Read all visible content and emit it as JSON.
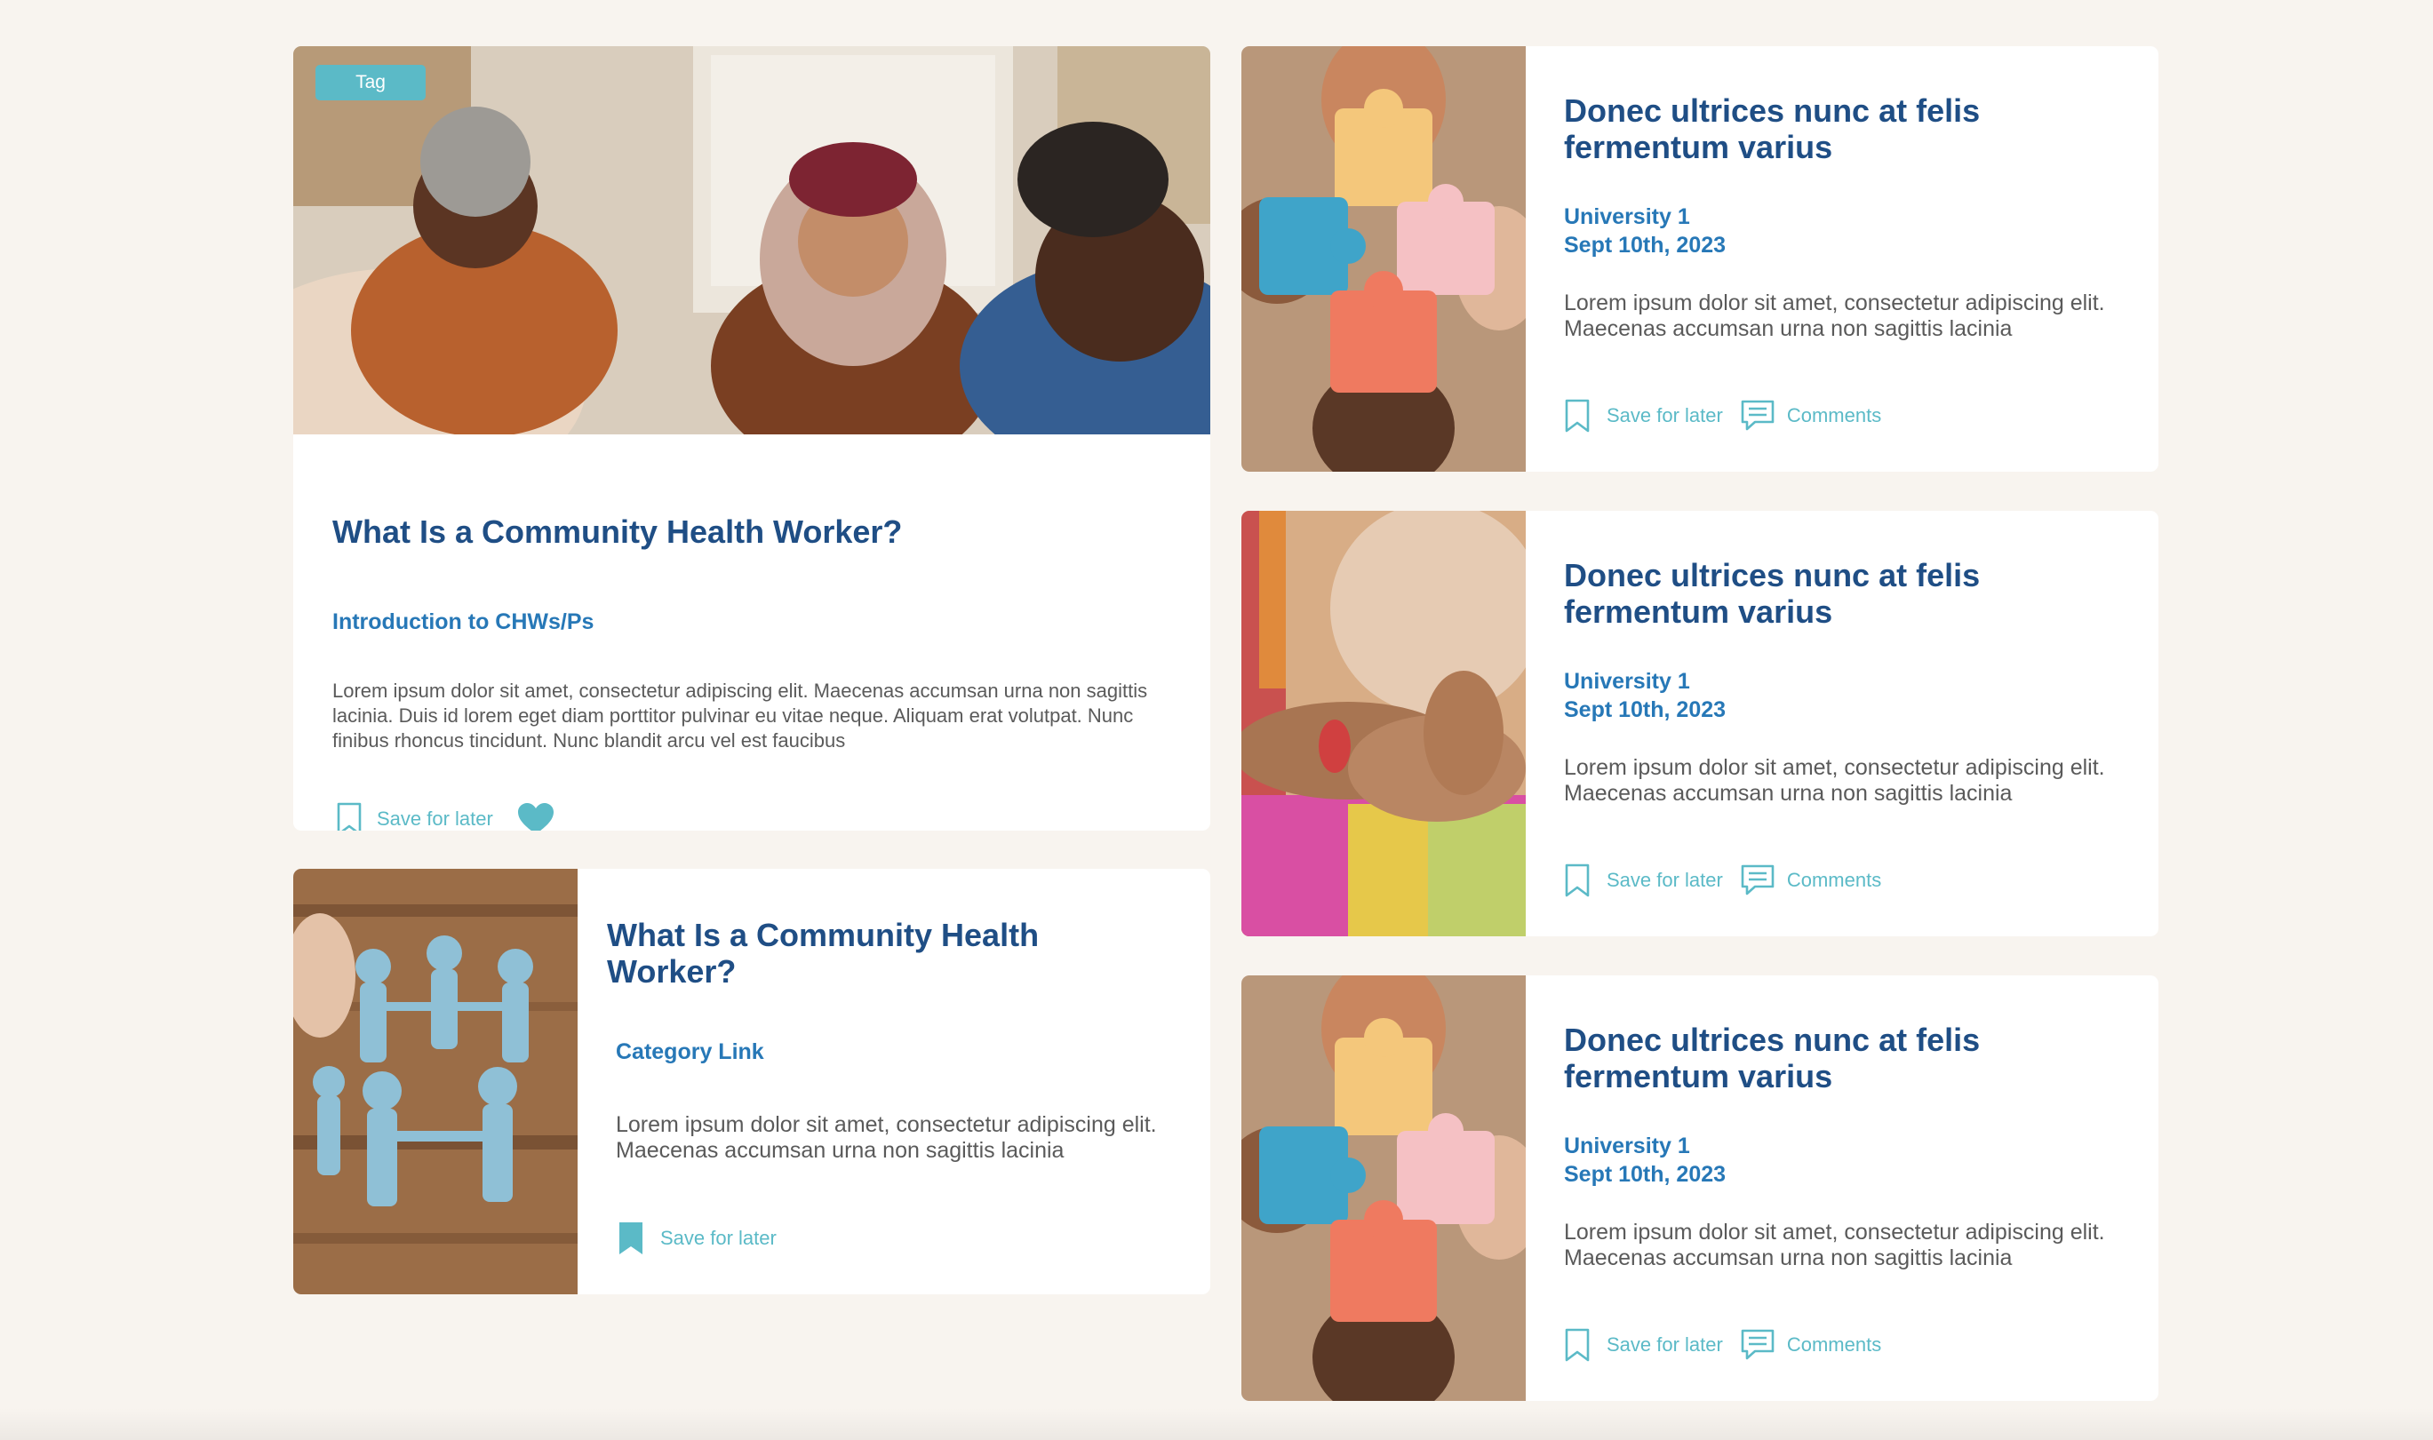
{
  "colors": {
    "background": "#f8f4ef",
    "card": "#ffffff",
    "title": "#1f4e85",
    "link": "#2778b7",
    "accent": "#5bbac7",
    "body_text": "#5a5a5a"
  },
  "featured": {
    "tag": "Tag",
    "title": "What Is a Community Health Worker?",
    "category": "Introduction to CHWs/Ps",
    "body": "Lorem ipsum dolor sit amet, consectetur adipiscing elit. Maecenas accumsan urna non sagittis lacinia. Duis id lorem eget diam porttitor pulvinar eu vitae neque. Aliquam erat volutpat. Nunc finibus rhoncus tincidunt. Nunc blandit arcu vel est faucibus",
    "save_label": "Save for later",
    "icons": [
      "bookmark-outline-icon",
      "heart-filled-icon"
    ]
  },
  "secondary": {
    "title": "What Is a Community Health Worker?",
    "category": "Category Link",
    "body": "Lorem ipsum dolor sit amet, consectetur adipiscing elit. Maecenas accumsan urna non sagittis lacinia",
    "save_label": "Save for later",
    "icons": [
      "bookmark-filled-icon"
    ]
  },
  "side_cards": [
    {
      "title": "Donec ultrices nunc at felis fermentum varius",
      "university": "University 1",
      "date": "Sept 10th, 2023",
      "body": "Lorem ipsum dolor sit amet, consectetur adipiscing elit. Maecenas accumsan urna non sagittis lacinia",
      "save_label": "Save for later",
      "comments_label": "Comments",
      "image": "puzzle-pieces-hands"
    },
    {
      "title": "Donec ultrices nunc at felis fermentum varius",
      "university": "University 1",
      "date": "Sept 10th, 2023",
      "body": "Lorem ipsum dolor sit amet, consectetur adipiscing elit. Maecenas accumsan urna non sagittis lacinia",
      "save_label": "Save for later",
      "comments_label": "Comments",
      "image": "holding-hands"
    },
    {
      "title": "Donec ultrices nunc at felis fermentum varius",
      "university": "University 1",
      "date": "Sept 10th, 2023",
      "body": "Lorem ipsum dolor sit amet, consectetur adipiscing elit. Maecenas accumsan urna non sagittis lacinia",
      "save_label": "Save for later",
      "comments_label": "Comments",
      "image": "puzzle-pieces-hands"
    }
  ]
}
